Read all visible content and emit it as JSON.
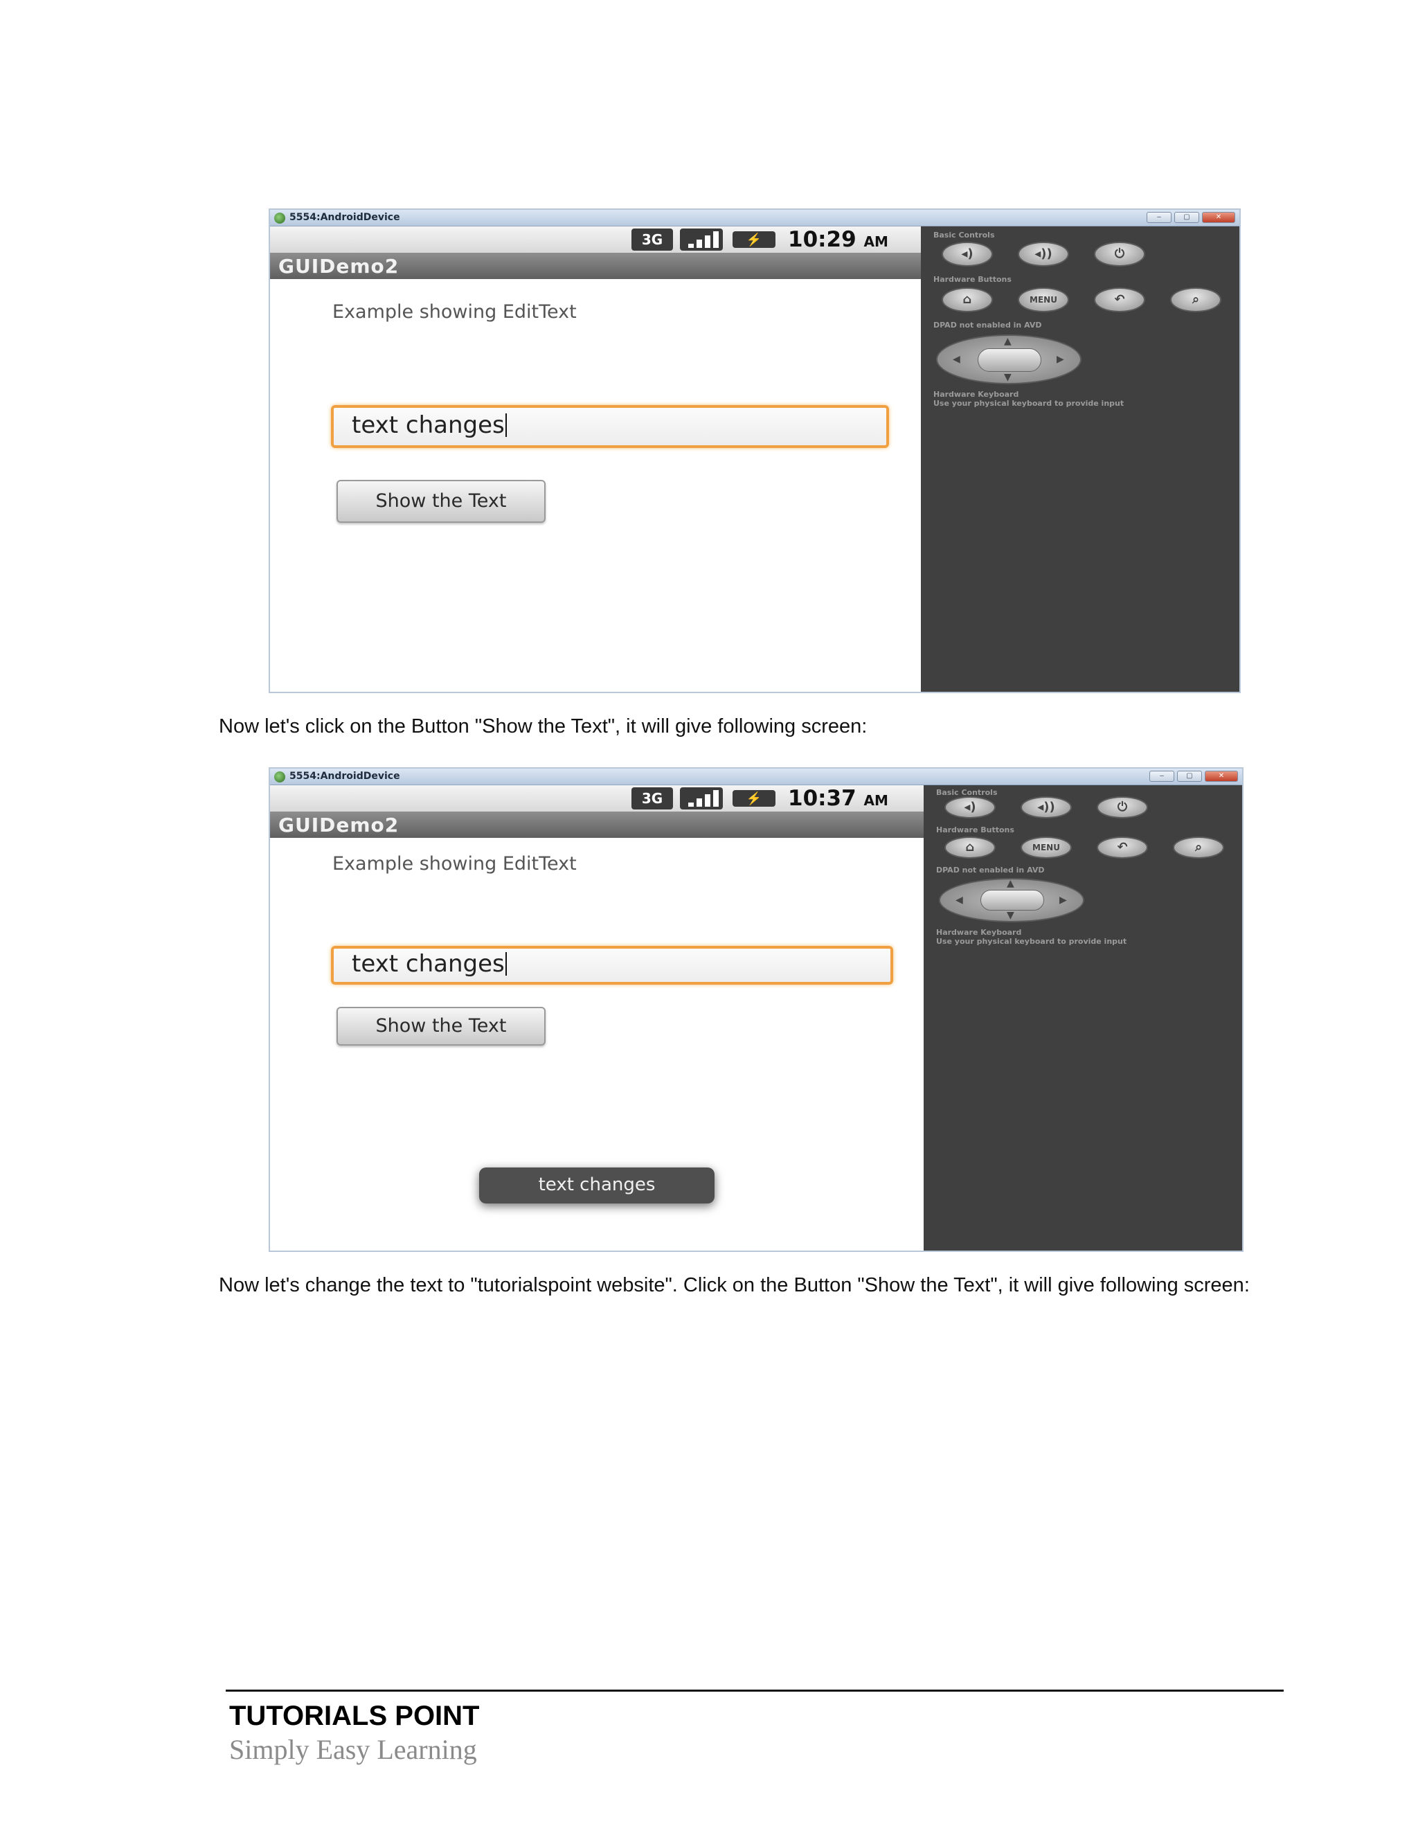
{
  "screenshots": [
    {
      "window_title": "5554:AndroidDevice",
      "window_buttons": [
        "–",
        "▢",
        "✕"
      ],
      "status": {
        "network": "3G",
        "time": "10:29",
        "ampm": "AM"
      },
      "app_title": "GUIDemo2",
      "label": "Example showing EditText",
      "edit_value": "text changes",
      "button_label": "Show the Text",
      "controls": {
        "basic_controls": "Basic Controls",
        "hardware_buttons": "Hardware Buttons",
        "menu_label": "MENU",
        "dpad_note": "DPAD not enabled in AVD",
        "keyboard_title": "Hardware Keyboard",
        "keyboard_note": "Use your physical keyboard to provide input"
      }
    },
    {
      "window_title": "5554:AndroidDevice",
      "window_buttons": [
        "–",
        "▢",
        "✕"
      ],
      "status": {
        "network": "3G",
        "time": "10:37",
        "ampm": "AM"
      },
      "app_title": "GUIDemo2",
      "label": "Example showing EditText",
      "edit_value": "text changes",
      "button_label": "Show the Text",
      "toast": "text changes",
      "controls": {
        "basic_controls": "Basic Controls",
        "hardware_buttons": "Hardware Buttons",
        "menu_label": "MENU",
        "dpad_note": "DPAD not enabled in AVD",
        "keyboard_title": "Hardware Keyboard",
        "keyboard_note": "Use your physical keyboard to provide input"
      }
    }
  ],
  "paragraphs": [
    "Now let's click on the Button \"Show the Text\", it will give following screen:",
    "Now let's change the text to \"tutorialspoint website\". Click on the Button \"Show the Text\", it will give following screen:"
  ],
  "footer": {
    "brand": "TUTORIALS POINT",
    "tagline": "Simply Easy Learning"
  }
}
